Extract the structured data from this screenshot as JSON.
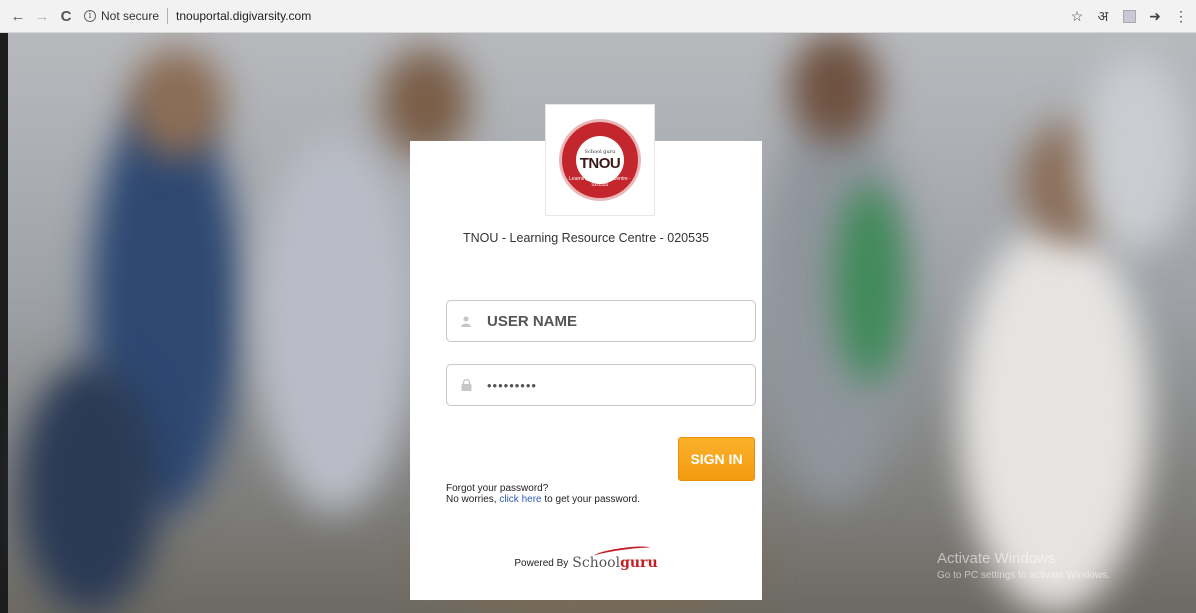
{
  "browser": {
    "security_label": "Not secure",
    "url": "tnouportal.digivarsity.com",
    "translate_glyph": "अ"
  },
  "logo": {
    "small_text": "School guru",
    "main_text": "TNOU",
    "ring_text": "Learning Resource Centre · 020535"
  },
  "login": {
    "centre_title": "TNOU - Learning Resource Centre - 020535",
    "username_placeholder": "USER NAME",
    "password_value": "•••••••••",
    "signin_label": "SIGN IN",
    "forgot_line1": "Forgot your password?",
    "forgot_prefix": "No worries, ",
    "forgot_link": "click here",
    "forgot_suffix": " to get your password."
  },
  "footer": {
    "powered_by": "Powered By",
    "brand_school": "School",
    "brand_guru": "guru"
  },
  "watermark": {
    "title": "Activate Windows",
    "subtitle": "Go to PC settings to activate Windows."
  },
  "colors": {
    "accent": "#f7a51d",
    "link": "#2f5fb3",
    "brand_red": "#c41e25"
  }
}
